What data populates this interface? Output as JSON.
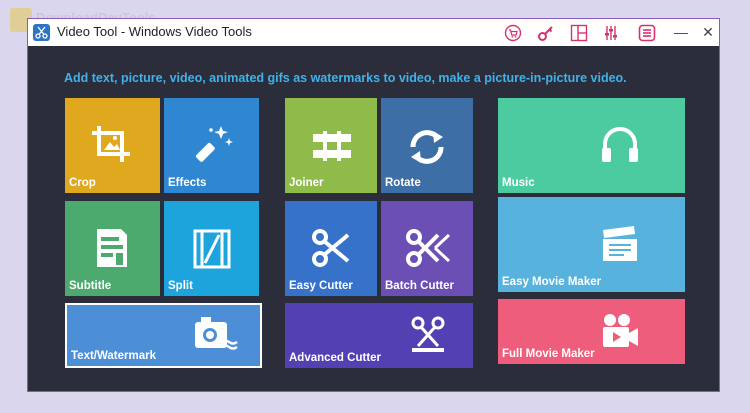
{
  "watermark": {
    "text": "DownloadDevTools"
  },
  "window": {
    "title": "Video Tool - Windows Video Tools",
    "controls": {
      "minimize": "—",
      "close": "✕"
    },
    "toolbar_icons": [
      "cart-icon",
      "key-icon",
      "layout-icon",
      "settings-sliders-icon",
      "menu-icon"
    ]
  },
  "headline": "Add text, picture, video, animated gifs as watermarks to video, make a picture-in-picture video.",
  "tiles": {
    "crop": {
      "label": "Crop",
      "color": "#e0a81f"
    },
    "effects": {
      "label": "Effects",
      "color": "#2e87d0"
    },
    "joiner": {
      "label": "Joiner",
      "color": "#8fbb4a"
    },
    "rotate": {
      "label": "Rotate",
      "color": "#3d6fa6"
    },
    "music": {
      "label": "Music",
      "color": "#4ccba0"
    },
    "subtitle": {
      "label": "Subtitle",
      "color": "#4caa6e"
    },
    "split": {
      "label": "Split",
      "color": "#1da4dc"
    },
    "easy_cutter": {
      "label": "Easy Cutter",
      "color": "#3672c9"
    },
    "batch_cutter": {
      "label": "Batch Cutter",
      "color": "#6b4fb4"
    },
    "easy_movie_maker": {
      "label": "Easy Movie Maker",
      "color": "#57b2de"
    },
    "text_watermark": {
      "label": "Text/Watermark",
      "color": "#4d8fd6"
    },
    "advanced_cutter": {
      "label": "Advanced Cutter",
      "color": "#5340b2"
    },
    "full_movie_maker": {
      "label": "Full Movie Maker",
      "color": "#ee5d7c"
    }
  }
}
